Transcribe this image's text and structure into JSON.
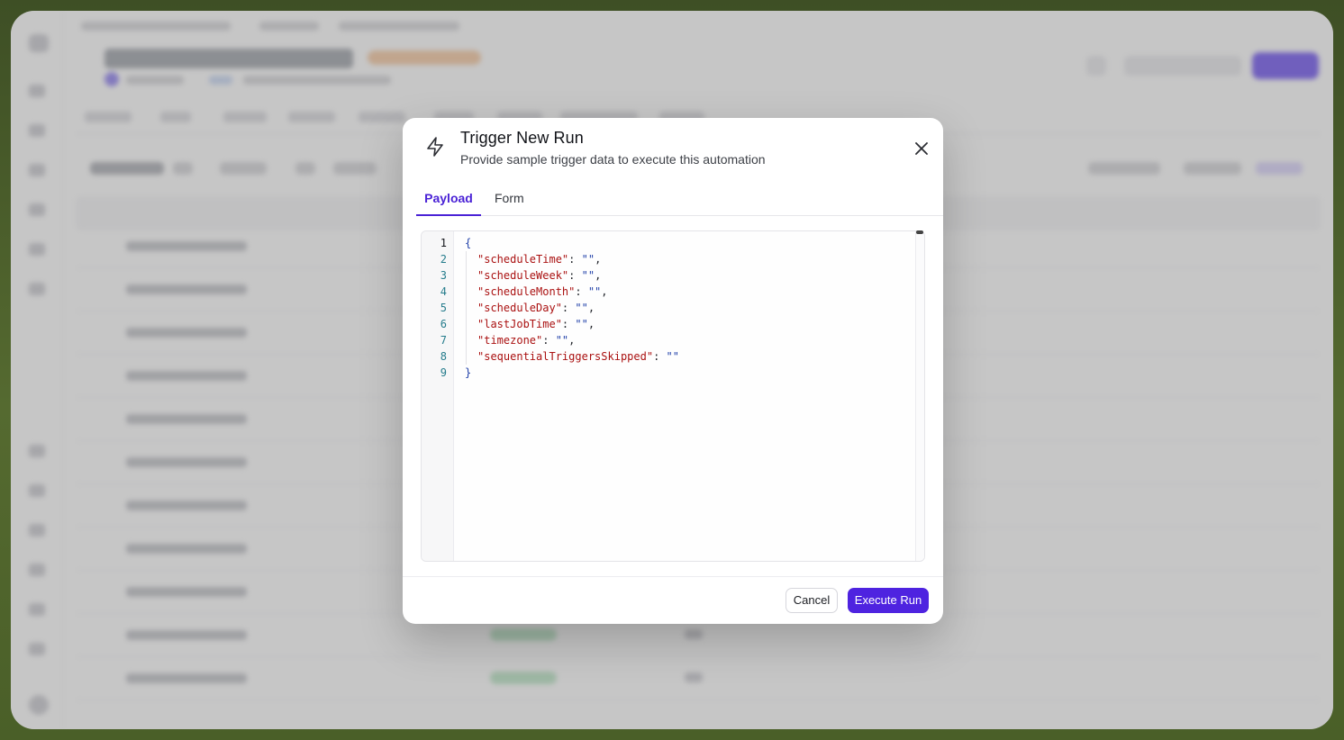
{
  "modal": {
    "title": "Trigger New Run",
    "description": "Provide sample trigger data to execute this automation",
    "icon": "bolt-icon",
    "close_icon": "close-icon",
    "tabs": [
      {
        "label": "Payload",
        "active": true
      },
      {
        "label": "Form",
        "active": false
      }
    ],
    "editor": {
      "language": "json",
      "active_line": 1,
      "line_numbers": [
        "1",
        "2",
        "3",
        "4",
        "5",
        "6",
        "7",
        "8",
        "9"
      ],
      "open_brace": "{",
      "close_brace": "}",
      "fields": [
        {
          "key": "\"scheduleTime\"",
          "value": "\"\"",
          "trailing": ","
        },
        {
          "key": "\"scheduleWeek\"",
          "value": "\"\"",
          "trailing": ","
        },
        {
          "key": "\"scheduleMonth\"",
          "value": "\"\"",
          "trailing": ","
        },
        {
          "key": "\"scheduleDay\"",
          "value": "\"\"",
          "trailing": ","
        },
        {
          "key": "\"lastJobTime\"",
          "value": "\"\"",
          "trailing": ","
        },
        {
          "key": "\"timezone\"",
          "value": "\"\"",
          "trailing": ","
        },
        {
          "key": "\"sequentialTriggersSkipped\"",
          "value": "\"\"",
          "trailing": ""
        }
      ]
    },
    "buttons": {
      "cancel_label": "Cancel",
      "execute_label": "Execute Run"
    }
  },
  "colors": {
    "accent": "#4e23e0",
    "json_key": "#aa1111",
    "json_string": "#1f3fa8",
    "line_number": "#257c8c",
    "scrim": "rgba(120,120,120,0.42)"
  }
}
